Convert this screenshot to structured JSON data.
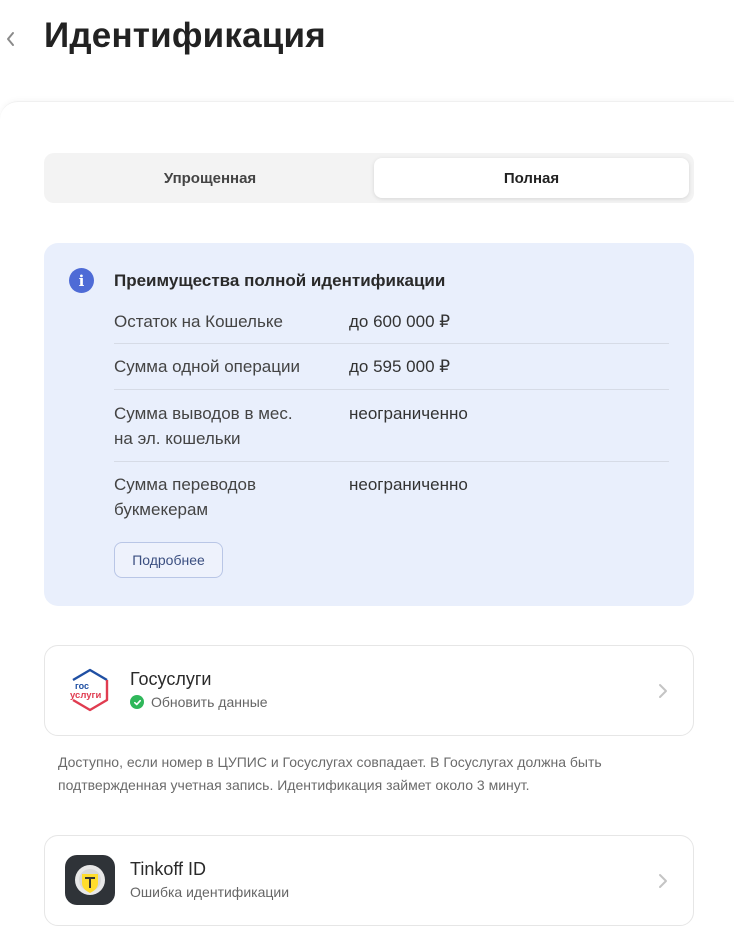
{
  "header": {
    "title": "Идентификация"
  },
  "tabs": [
    {
      "label": "Упрощенная",
      "selected": false
    },
    {
      "label": "Полная",
      "selected": true
    }
  ],
  "info": {
    "title": "Преимущества полной идентификации",
    "rows": [
      {
        "label": "Остаток на Кошельке",
        "value": "до 600 000 ₽"
      },
      {
        "label": "Сумма одной операции",
        "value": "до 595 000 ₽"
      },
      {
        "label_lines": [
          "Сумма выводов в мес.",
          "на эл. кошельки"
        ],
        "value": "неограниченно"
      },
      {
        "label_lines": [
          "Сумма переводов",
          "букмекерам"
        ],
        "value": "неограниченно"
      }
    ],
    "more_button": "Подробнее"
  },
  "gosuslugi": {
    "name": "Госуслуги",
    "status": "Обновить данные",
    "logo_text": {
      "top": "гос",
      "bottom": "услуги"
    },
    "note": "Доступно, если номер в ЦУПИС и Госуслугах совпадает. В Госуслугах должна быть подтвержденная учетная запись. Идентификация займет около 3 минут."
  },
  "tinkoff": {
    "name": "Tinkoff ID",
    "status": "Ошибка идентификации"
  },
  "colors": {
    "accent_blue": "#4e6bd6",
    "info_bg": "#e9effc",
    "success_green": "#2fb75a",
    "gos_blue": "#1f4fa3",
    "gos_red": "#e03c50"
  },
  "icons": {
    "back": "chevron-left-icon",
    "info": "info-icon",
    "check": "check-circle-icon",
    "chevron": "chevron-right-icon"
  }
}
